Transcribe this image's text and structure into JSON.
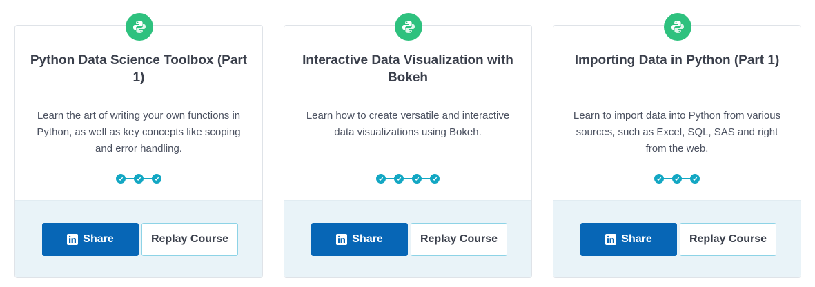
{
  "colors": {
    "badge_green": "#2ec17e",
    "progress_teal": "#13a7c3",
    "share_blue": "#0766b6",
    "footer_bg": "#e9f3f8",
    "replay_border": "#8dd3e6"
  },
  "icons": {
    "badge": "python-logo-icon",
    "progress_step": "checkmark-icon",
    "share": "linkedin-icon"
  },
  "cards": [
    {
      "title": "Python Data Science Toolbox (Part 1)",
      "description": "Learn the art of writing your own functions in Python, as well as key concepts like scoping and error handling.",
      "completed_chapters": 3,
      "share_label": "Share",
      "replay_label": "Replay Course"
    },
    {
      "title": "Interactive Data Visualization with Bokeh",
      "description": "Learn how to create versatile and interactive data visualizations using Bokeh.",
      "completed_chapters": 4,
      "share_label": "Share",
      "replay_label": "Replay Course"
    },
    {
      "title": "Importing Data in Python (Part 1)",
      "description": "Learn to import data into Python from various sources, such as Excel, SQL, SAS and right from the web.",
      "completed_chapters": 3,
      "share_label": "Share",
      "replay_label": "Replay Course"
    }
  ]
}
